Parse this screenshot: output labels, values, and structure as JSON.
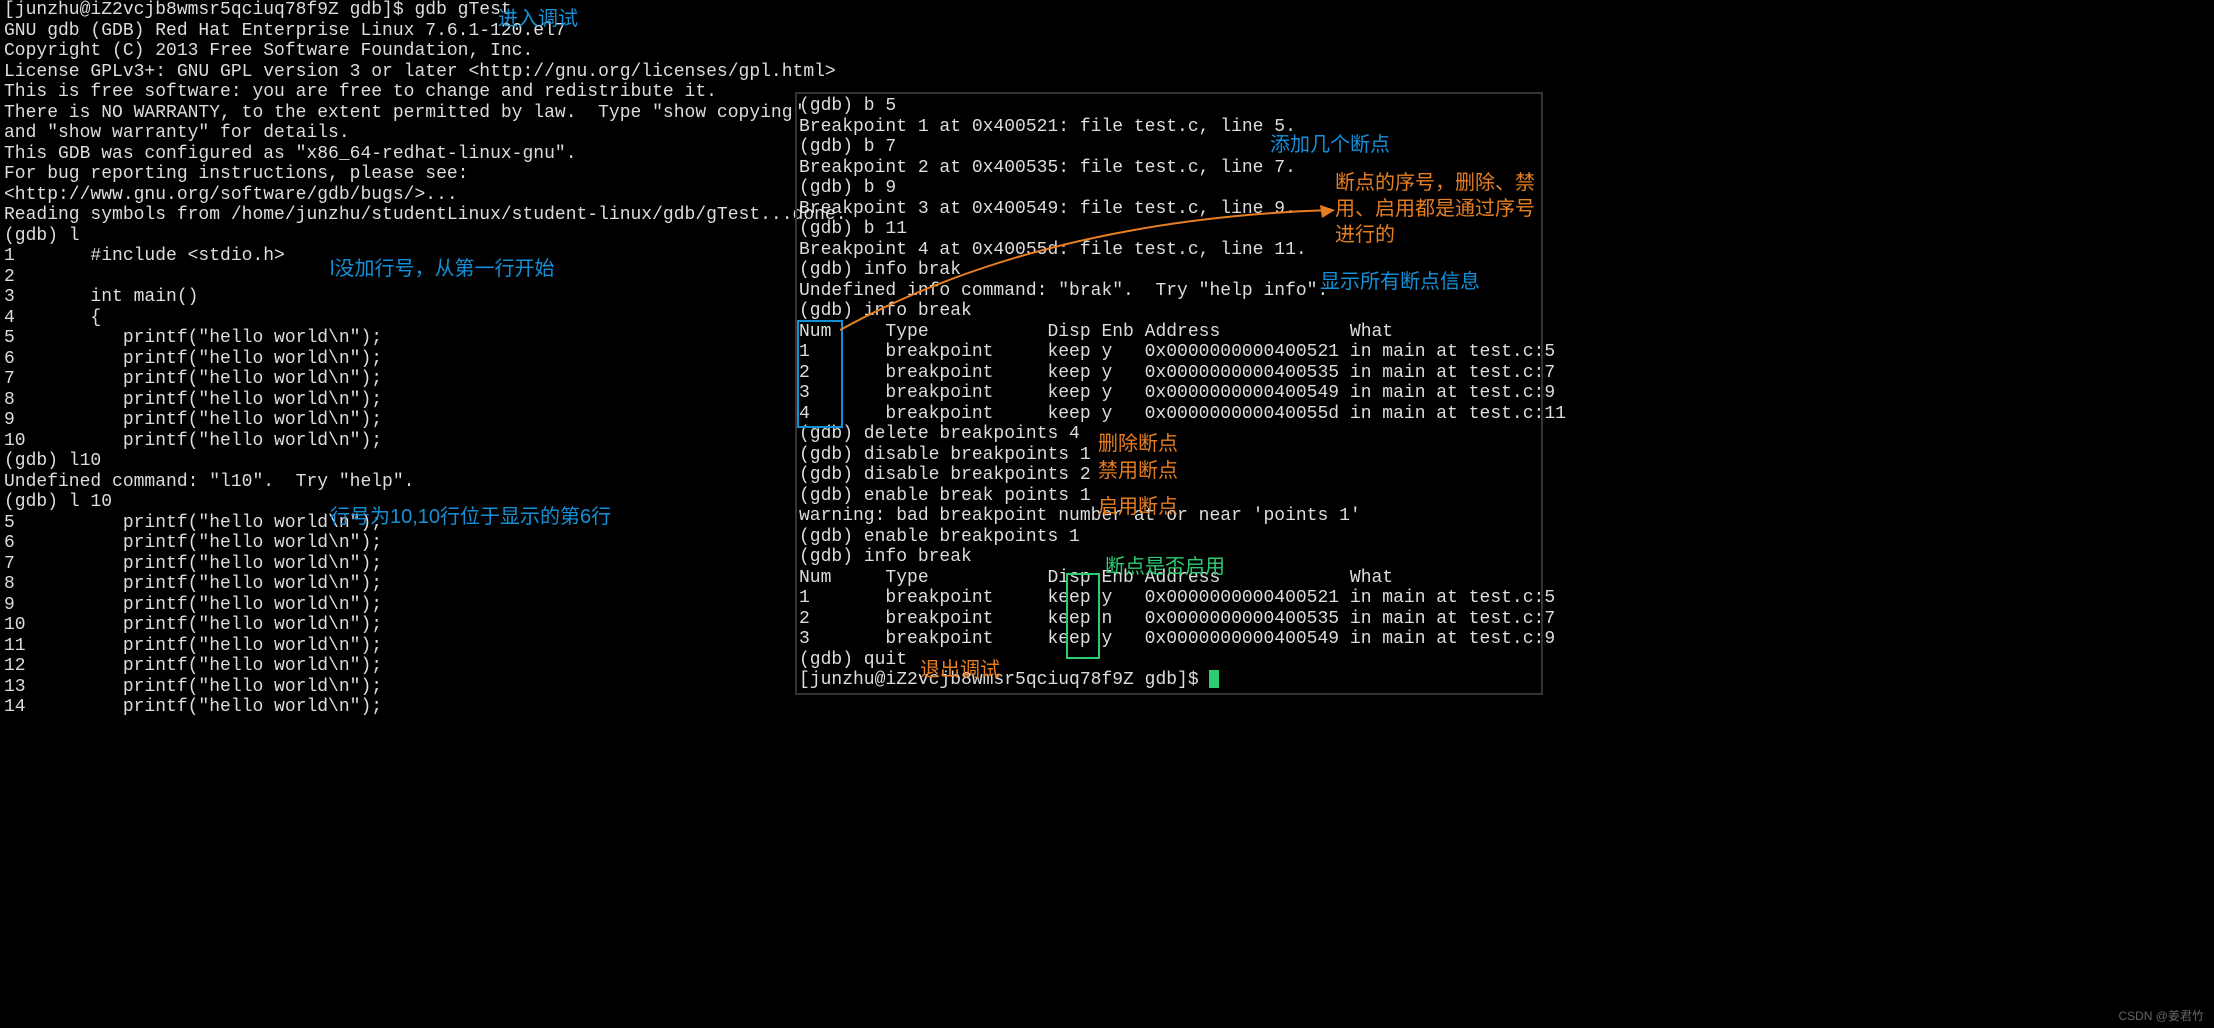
{
  "left": {
    "prompt1": "[junzhu@iZ2vcjb8wmsr5qciuq78f9Z gdb]$ gdb gTest",
    "header1": "GNU gdb (GDB) Red Hat Enterprise Linux 7.6.1-120.el7",
    "header2": "Copyright (C) 2013 Free Software Foundation, Inc.",
    "header3": "License GPLv3+: GNU GPL version 3 or later <http://gnu.org/licenses/gpl.html>",
    "header4": "This is free software: you are free to change and redistribute it.",
    "header5": "There is NO WARRANTY, to the extent permitted by law.  Type \"show copying\"",
    "header6": "and \"show warranty\" for details.",
    "header7": "This GDB was configured as \"x86_64-redhat-linux-gnu\".",
    "header8": "For bug reporting instructions, please see:",
    "header9": "<http://www.gnu.org/software/gdb/bugs/>...",
    "header10": "Reading symbols from /home/junzhu/studentLinux/student-linux/gdb/gTest...done.",
    "gdb_l": "(gdb) l",
    "src1": "1       #include <stdio.h>",
    "src2": "2",
    "src3": "3       int main()",
    "src4": "4       {",
    "src5": "5          printf(\"hello world\\n\");",
    "src6": "6          printf(\"hello world\\n\");",
    "src7": "7          printf(\"hello world\\n\");",
    "src8": "8          printf(\"hello world\\n\");",
    "src9": "9          printf(\"hello world\\n\");",
    "src10": "10         printf(\"hello world\\n\");",
    "gdb_l10bad": "(gdb) l10",
    "undef": "Undefined command: \"l10\".  Try \"help\".",
    "gdb_l10": "(gdb) l 10",
    "l5": "5          printf(\"hello world\\n\");",
    "l6": "6          printf(\"hello world\\n\");",
    "l7": "7          printf(\"hello world\\n\");",
    "l8": "8          printf(\"hello world\\n\");",
    "l9": "9          printf(\"hello world\\n\");",
    "l10": "10         printf(\"hello world\\n\");",
    "l11": "11         printf(\"hello world\\n\");",
    "l12": "12         printf(\"hello world\\n\");",
    "l13": "13         printf(\"hello world\\n\");",
    "l14": "14         printf(\"hello world\\n\");"
  },
  "right": {
    "b5": "(gdb) b 5",
    "bp1": "Breakpoint 1 at 0x400521: file test.c, line 5.",
    "b7": "(gdb) b 7",
    "bp2": "Breakpoint 2 at 0x400535: file test.c, line 7.",
    "b9": "(gdb) b 9",
    "bp3": "Breakpoint 3 at 0x400549: file test.c, line 9.",
    "b11": "(gdb) b 11",
    "bp4": "Breakpoint 4 at 0x40055d: file test.c, line 11.",
    "infobrak": "(gdb) info brak",
    "undefinfo": "Undefined info command: \"brak\".  Try \"help info\".",
    "infobreak": "(gdb) info break",
    "hdr1": "Num     Type           Disp Enb Address            What",
    "row1": "1       breakpoint     keep y   0x0000000000400521 in main at test.c:5",
    "row2": "2       breakpoint     keep y   0x0000000000400535 in main at test.c:7",
    "row3": "3       breakpoint     keep y   0x0000000000400549 in main at test.c:9",
    "row4": "4       breakpoint     keep y   0x000000000040055d in main at test.c:11",
    "del4": "(gdb) delete breakpoints 4",
    "dis1": "(gdb) disable breakpoints 1",
    "dis2": "(gdb) disable breakpoints 2",
    "enbad": "(gdb) enable break points 1",
    "warn": "warning: bad breakpoint number at or near 'points 1'",
    "en1": "(gdb) enable breakpoints 1",
    "infobreak2": "(gdb) info break",
    "hdr2": "Num     Type           Disp Enb Address            What",
    "r1": "1       breakpoint     keep y   0x0000000000400521 in main at test.c:5",
    "r2": "2       breakpoint     keep n   0x0000000000400535 in main at test.c:7",
    "r3": "3       breakpoint     keep y   0x0000000000400549 in main at test.c:9",
    "quit": "(gdb) quit",
    "prompt": "[junzhu@iZ2vcjb8wmsr5qciuq78f9Z gdb]$ "
  },
  "annotations": {
    "enter_debug": "进入调试",
    "no_line_start": "l没加行号，从第一行开始",
    "line10_pos": "行号为10,10行位于显示的第6行",
    "add_bp": "添加几个断点",
    "bp_seq": "断点的序号，删除、禁用、启用都是通过序号进行的",
    "show_all_bp": "显示所有断点信息",
    "del_bp": "删除断点",
    "dis_bp": "禁用断点",
    "en_bp": "启用断点",
    "is_enabled": "断点是否启用",
    "quit_debug": "退出调试"
  },
  "watermark": "CSDN @姜君竹"
}
